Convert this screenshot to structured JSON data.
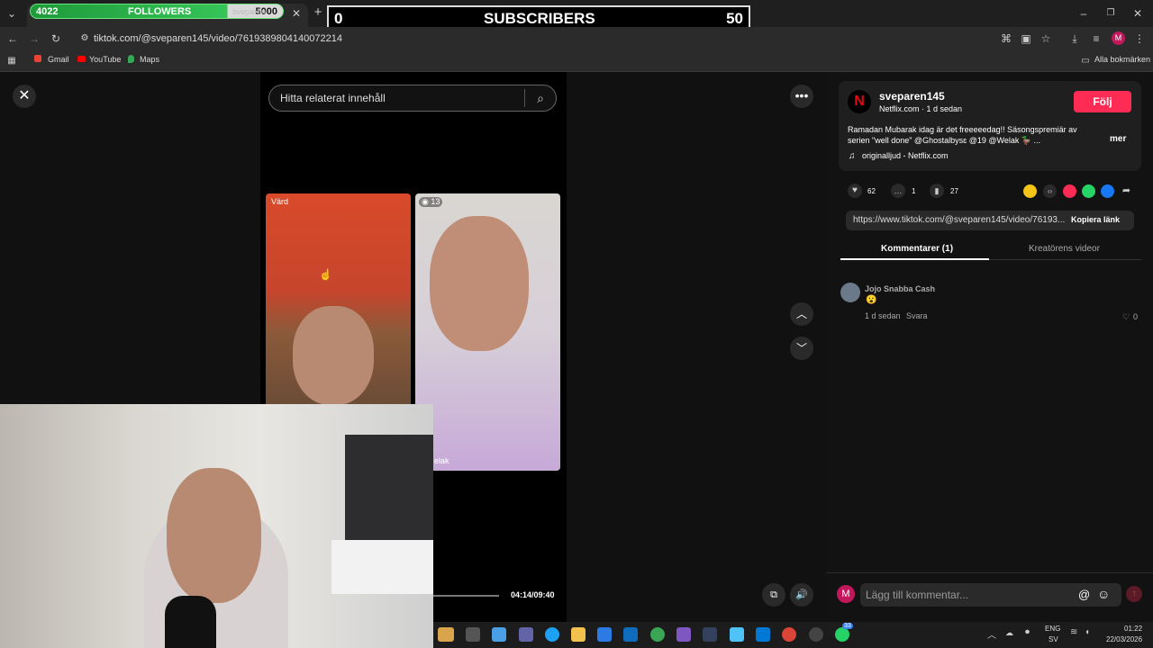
{
  "overlay": {
    "followers_current": "4022",
    "followers_label": "FOLLOWERS",
    "followers_goal": "5000",
    "tab_hint": "sveparen",
    "subs_current": "0",
    "subs_label": "SUBSCRIBERS",
    "subs_goal": "50"
  },
  "browser": {
    "url": "tiktok.com/@sveparen145/video/7619389804140072214",
    "bookmarks": [
      "Gmail",
      "YouTube",
      "Maps"
    ],
    "all_bookmarks": "Alla bokmärken",
    "avatar_letter": "M"
  },
  "viewer": {
    "search_placeholder": "Hitta relaterat innehåll",
    "host_label": "Värd",
    "viewer_count": "13",
    "name_tag": "elak",
    "time": "04:14/09:40"
  },
  "post": {
    "username": "sveparen145",
    "meta": "Netflix.com · 1 d sedan",
    "follow": "Följ",
    "caption": "Ramadan Mubarak idag är det freeeeedag!! Säsongspremiär av serien \"well done\" @Ghostalbysɛ @19 @Welak 🦆 ...",
    "more": "mer",
    "sound": "originalljud - Netflix.com",
    "likes": "62",
    "comments": "1",
    "saves": "27",
    "link": "https://www.tiktok.com/@sveparen145/video/76193...",
    "copy_link": "Kopiera länk"
  },
  "tabs": {
    "comments": "Kommentarer (1)",
    "creator": "Kreatörens videor"
  },
  "comment": {
    "author": "Jojo Snabba Cash",
    "emoji": "😮",
    "time": "1 d sedan",
    "reply": "Svara",
    "likes": "0"
  },
  "composer": {
    "placeholder": "Lägg till kommentar...",
    "avatar": "M"
  },
  "taskbar": {
    "lang": "ENG",
    "lang2": "SV",
    "time": "01:22",
    "date": "22/03/2026",
    "badge": "33"
  }
}
